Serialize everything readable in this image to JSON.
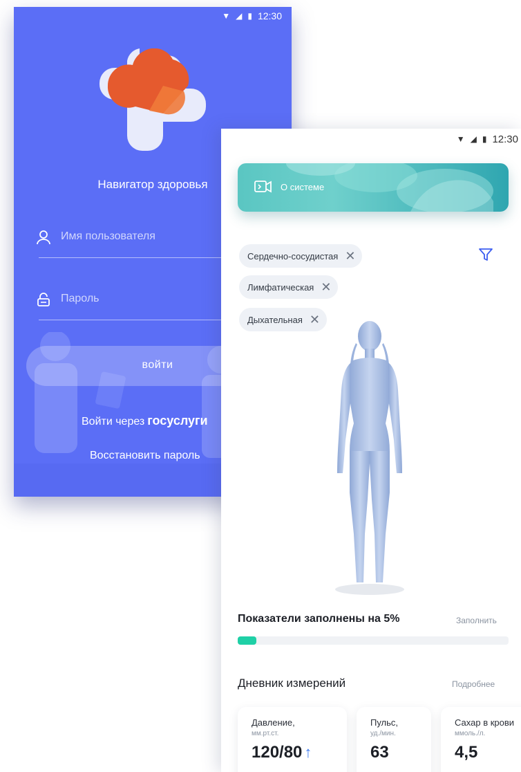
{
  "login": {
    "status_time": "12:30",
    "app_title": "Навигатор здоровья",
    "username_placeholder": "Имя пользователя",
    "password_placeholder": "Пароль",
    "login_button": "войти",
    "gosuslugi_prefix": "Войти через",
    "gosuslugi_brand": "госуслуги",
    "restore_password": "Восстановить пароль",
    "colors": {
      "background": "#5b6ef6",
      "logo_orange": "#e55a2e",
      "logo_white": "#e8ebfb"
    }
  },
  "main": {
    "status_time": "12:30",
    "banner_label": "О системе",
    "filters": [
      "Сердечно-сосудистая",
      "Лимфатическая",
      "Дыхательная"
    ],
    "progress": {
      "title": "Показатели заполнены на 5%",
      "fraction": 0.05,
      "fill_label": "Заполнить"
    },
    "diary": {
      "title": "Дневник измерений",
      "more_label": "Подробнее",
      "cards": [
        {
          "title": "Давление,",
          "unit": "мм.рт.ст.",
          "value": "120/80",
          "trend": "↑"
        },
        {
          "title": "Пульс,",
          "unit": "уд./мин.",
          "value": "63",
          "trend": ""
        },
        {
          "title": "Сахар в крови",
          "unit": "ммоль./л.",
          "value": "4,5",
          "trend": ""
        }
      ]
    },
    "colors": {
      "accent": "#1fd0a6",
      "filter_icon": "#3d5ef0",
      "trend": "#3d7bf0"
    }
  }
}
